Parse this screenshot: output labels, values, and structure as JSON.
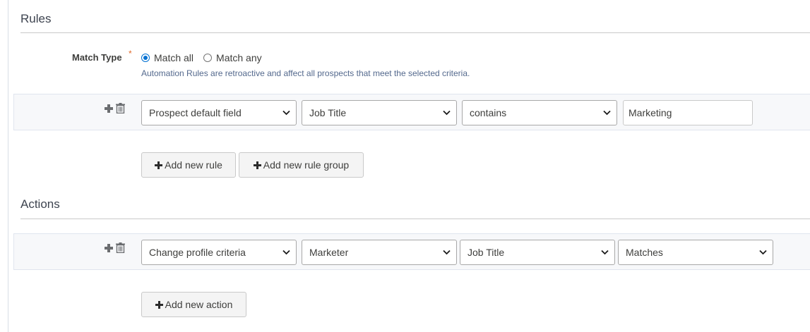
{
  "rules": {
    "title": "Rules",
    "match_type": {
      "label": "Match Type",
      "required_mark": "*",
      "options": [
        {
          "label": "Match all",
          "checked": true
        },
        {
          "label": "Match any",
          "checked": false
        }
      ],
      "help": "Automation Rules are retroactive and affect all prospects that meet the selected criteria."
    },
    "rule_row": {
      "field_type": "Prospect default field",
      "field": "Job Title",
      "operator": "contains",
      "value": "Marketing"
    },
    "add_rule_label": "Add new rule",
    "add_group_label": "Add new rule group"
  },
  "actions": {
    "title": "Actions",
    "action_row": {
      "action_type": "Change profile criteria",
      "profile": "Marketer",
      "criteria": "Job Title",
      "match": "Matches"
    },
    "add_action_label": "Add new action"
  },
  "colors": {
    "accent": "#0070d2",
    "required": "#e06a2b",
    "band": "#f7f8fa"
  }
}
